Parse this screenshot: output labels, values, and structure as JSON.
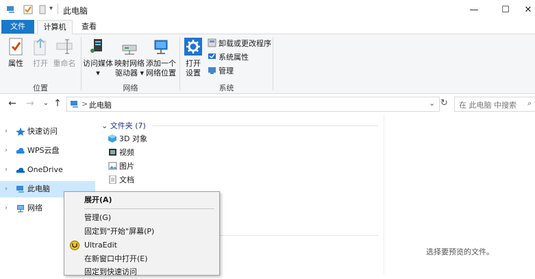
{
  "window": {
    "title": "此电脑",
    "controls": {
      "minimize": "—",
      "maximize": "☐",
      "close": "✕"
    }
  },
  "ribbon_tabs": [
    "文件",
    "计算机",
    "查看"
  ],
  "ribbon": {
    "location_group": {
      "label": "位置",
      "buttons": [
        "属性",
        "打开",
        "重命名"
      ]
    },
    "network_group": {
      "label": "网络",
      "buttons": [
        {
          "line1": "访问媒体",
          "line2": "▾"
        },
        {
          "line1": "映射网络",
          "line2": "驱动器 ▾"
        },
        {
          "line1": "添加一个",
          "line2": "网络位置"
        }
      ]
    },
    "system_group": {
      "label": "系统",
      "open_settings": {
        "line1": "打开",
        "line2": "设置"
      },
      "small_buttons": [
        "卸载或更改程序",
        "系统属性",
        "管理"
      ]
    }
  },
  "addressbar": {
    "path": "此电脑",
    "separator": ">",
    "search_placeholder": "在 此电脑 中搜索"
  },
  "nav_pane": {
    "items": [
      "快速访问",
      "WPS云盘",
      "OneDrive",
      "此电脑",
      "网络"
    ]
  },
  "content": {
    "group_header": "文件夹 (7)",
    "folders": [
      "3D 对象",
      "视频",
      "图片",
      "文档"
    ]
  },
  "preview": {
    "text": "选择要预览的文件。"
  },
  "context_menu": {
    "items": [
      "展开(A)",
      "管理(G)",
      "固定到\"开始\"屏幕(P)",
      "UltraEdit",
      "在新窗口中打开(E)",
      "固定到快速访问"
    ]
  },
  "colors": {
    "accent": "#1979ca",
    "selected": "#cce8ff",
    "folder_header": "#1e3287"
  }
}
